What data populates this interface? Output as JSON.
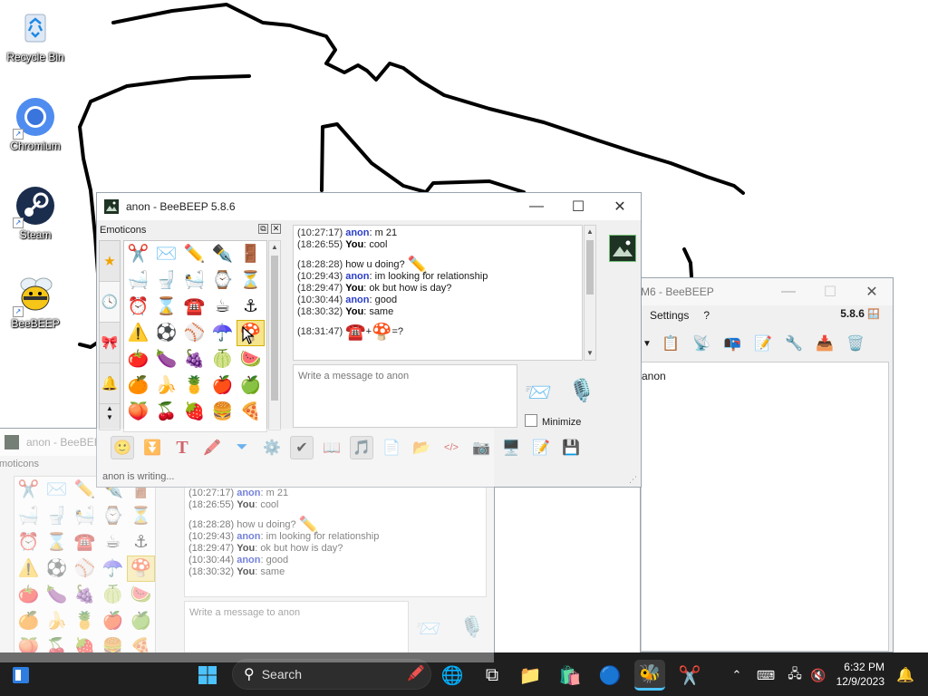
{
  "desktop": {
    "icons": [
      {
        "label": "Recycle Bin"
      },
      {
        "label": "Chromium"
      },
      {
        "label": "Steam"
      },
      {
        "label": "BeeBEEP"
      }
    ]
  },
  "main_window": {
    "title": "anon - BeeBEEP 5.8.6",
    "emoticons_header": "Emoticons",
    "chat_log": [
      {
        "time": "(10:27:17)",
        "sender": "anon",
        "text": "m 21"
      },
      {
        "time": "(18:26:55)",
        "sender": "You",
        "text": "cool"
      },
      {
        "gap": true
      },
      {
        "time": "(18:28:28)",
        "sender": "",
        "text": "how u doing?",
        "emoji": "✏️"
      },
      {
        "time": "(10:29:43)",
        "sender": "anon",
        "text": "im looking for relationship"
      },
      {
        "time": "(18:29:47)",
        "sender": "You",
        "text": "ok but how is day?"
      },
      {
        "time": "(10:30:44)",
        "sender": "anon",
        "text": "good"
      },
      {
        "time": "(18:30:32)",
        "sender": "You",
        "text": "same"
      },
      {
        "gap": true
      },
      {
        "time": "(18:31:47)",
        "sender": "",
        "text": "=?",
        "emoji_pre": "☎️",
        "plus": "+",
        "emoji_mid": "🍄"
      }
    ],
    "input_placeholder": "Write a message to anon",
    "minimize_label": "Minimize",
    "status_text": "anon is writing...",
    "emoticons": [
      "✂️",
      "✉️",
      "✏️",
      "✒️",
      "🚪",
      "🛁",
      "🚽",
      "🛀",
      "⌚",
      "⏳",
      "⏰",
      "⌛",
      "☎️",
      "☕",
      "⚓",
      "⚠️",
      "⚽",
      "⚾",
      "☂️",
      "🍄",
      "🍅",
      "🍆",
      "🍇",
      "🍈",
      "🍉",
      "🍊",
      "🍌",
      "🍍",
      "🍎",
      "🍏",
      "🍑",
      "🍒",
      "🍓",
      "🍔",
      "🍕"
    ]
  },
  "back_window": {
    "title": "anon - BeeBEEP 5",
    "emoticons_header": "moticons",
    "chat_log": [
      {
        "time": "(10:27:17)",
        "sender": "anon",
        "text": "m 21"
      },
      {
        "time": "(18:26:55)",
        "sender": "You",
        "text": "cool"
      },
      {
        "gap": true
      },
      {
        "time": "(18:28:28)",
        "sender": "",
        "text": "how u doing?",
        "emoji": "✏️"
      },
      {
        "time": "(10:29:43)",
        "sender": "anon",
        "text": "im looking for relationship"
      },
      {
        "time": "(18:29:47)",
        "sender": "You",
        "text": "ok but how is day?"
      },
      {
        "time": "(10:30:44)",
        "sender": "anon",
        "text": "good"
      },
      {
        "time": "(18:30:32)",
        "sender": "You",
        "text": "same"
      }
    ],
    "input_placeholder": "Write a message to anon"
  },
  "right_window": {
    "title": "M6 - BeeBEEP",
    "menu": [
      "Settings",
      "?"
    ],
    "version": "5.8.6",
    "user": "anon"
  },
  "taskbar": {
    "search_label": "Search",
    "time": "6:32 PM",
    "date": "12/9/2023"
  },
  "colors": {
    "accent": "#2b3ec7",
    "taskbar": "#1f1f1f"
  }
}
